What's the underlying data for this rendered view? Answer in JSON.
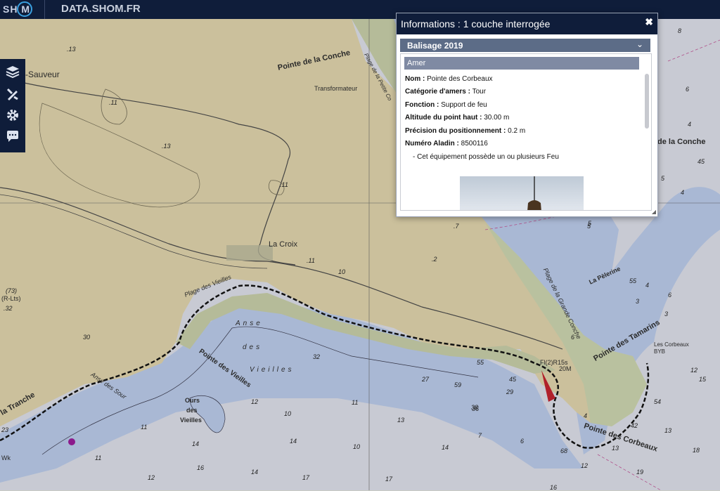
{
  "header": {
    "logo_text": "SH  M",
    "site_name": "DATA.SHOM.FR"
  },
  "toolbar": {
    "layers_icon": "layers-icon",
    "tools_icon": "ruler-pencil-icon",
    "settings_icon": "gear-icon",
    "comment_icon": "chat-bubble-icon"
  },
  "popup": {
    "title": "Informations : 1 couche interrogée",
    "close_glyph": "✖",
    "layer_name": "Balisage 2019",
    "chevron_glyph": "⌄",
    "feature_type": "Amer",
    "attributes": [
      {
        "key": "Nom :",
        "value": "Pointe des Corbeaux"
      },
      {
        "key": "Catégorie d'amers :",
        "value": "Tour"
      },
      {
        "key": "Fonction :",
        "value": "Support de feu"
      },
      {
        "key": "Altitude du point haut :",
        "value": "30.00 m"
      },
      {
        "key": "Précision du positionnement :",
        "value": "0.2 m"
      },
      {
        "key": "Numéro Aladin :",
        "value": "8500116"
      }
    ],
    "note": "- Cet équipement possède un ou plusieurs Feu"
  },
  "map": {
    "place_labels": [
      "-Sauveur",
      "Pointe de la Conche",
      "Transformateur",
      "La Croix",
      "Plage des Vieilles",
      "Anse",
      "des",
      "Vieilles",
      "Pointe des Vieilles",
      "Anse des Sour",
      "la Tranche",
      "Ours",
      "des",
      "Vieilles",
      "La Pèlerine",
      "Pointe des Tamarins",
      "Les Corbeaux",
      "BYB",
      "Pointe des Corbeaux",
      "Plage de la Grande Conche",
      "de la Conche",
      "(R-Lts)",
      "Fl(2)R15s",
      "20M",
      "Plage de la Petite Co",
      "Wk"
    ],
    "depth_labels": [
      ".13",
      ".11",
      ".13",
      ".11",
      ".11",
      ".7",
      ".2",
      "10",
      "(73)",
      ".32",
      "30",
      "8",
      "6",
      "4",
      "45",
      "5",
      "4",
      "45",
      "5",
      "3",
      "4",
      "55",
      "6",
      "3",
      "12",
      "15",
      "13",
      "18",
      "19",
      "13",
      "12",
      "16",
      "14",
      "16",
      "14",
      "17",
      "17",
      "10",
      "11",
      "11",
      "12",
      "14",
      "14",
      "10",
      "12",
      "13",
      "11",
      "7",
      "6",
      "5",
      "68",
      "42",
      "6",
      "4",
      "36",
      "32",
      "23",
      "27",
      "45",
      "54",
      "59",
      "55",
      "29",
      "38"
    ]
  }
}
